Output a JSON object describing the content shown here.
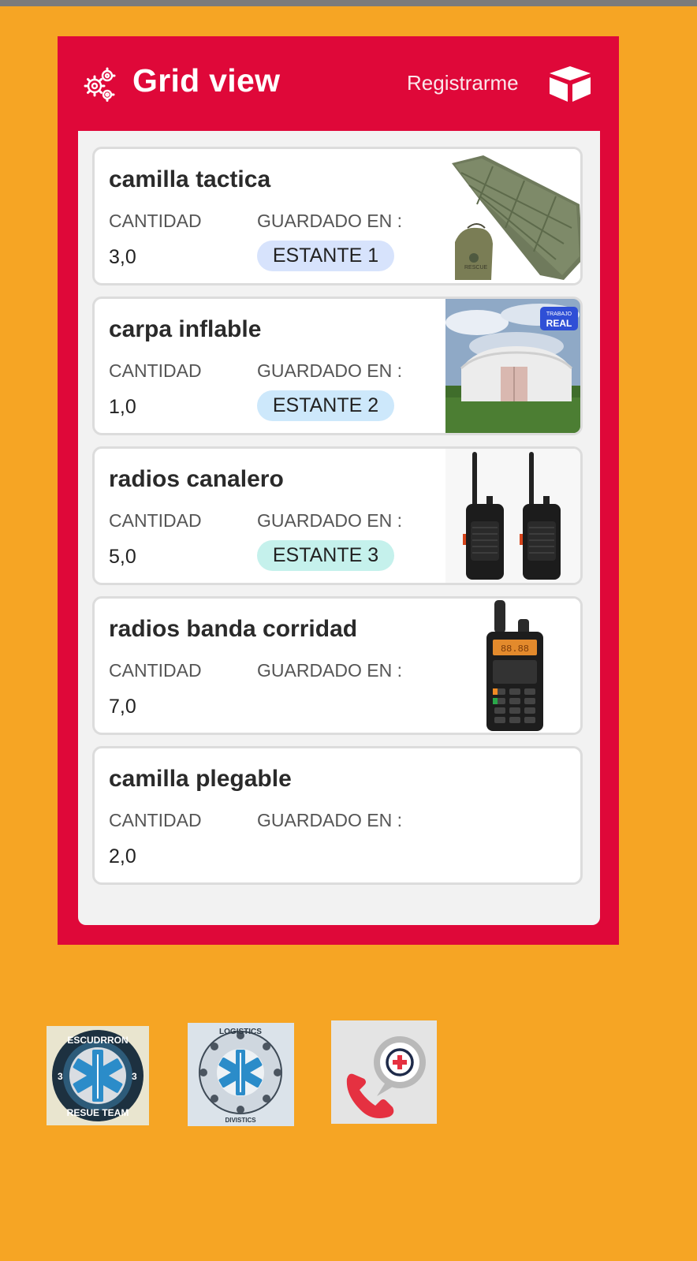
{
  "header": {
    "title": "Grid view",
    "register_label": "Registrarme",
    "settings_icon": "gears-icon",
    "box_icon": "cube-icon"
  },
  "labels": {
    "quantity": "CANTIDAD",
    "stored_in": "GUARDADO EN :"
  },
  "items": [
    {
      "name": "camilla tactica",
      "quantity": "3,0",
      "location": "ESTANTE 1",
      "badge_color": "#D7E3FC",
      "image": "tactical-stretcher-image"
    },
    {
      "name": "carpa inflable",
      "quantity": "1,0",
      "location": "ESTANTE 2",
      "badge_color": "#CDE8FB",
      "image": "inflatable-tent-image"
    },
    {
      "name": "radios canalero",
      "quantity": "5,0",
      "location": "ESTANTE 3",
      "badge_color": "#C5F1EC",
      "image": "walkie-talkie-pair-image"
    },
    {
      "name": "radios banda corridad",
      "quantity": "7,0",
      "location": "",
      "image": "dual-band-radio-image"
    },
    {
      "name": "camilla plegable",
      "quantity": "2,0",
      "location": "",
      "image": ""
    }
  ],
  "logos": [
    {
      "name": "escuadron-rescue-team-logo",
      "text_top": "ESCUDRRON",
      "text_bottom": "RESUE TEAM",
      "number": "3"
    },
    {
      "name": "logistics-logo",
      "text_top": "LOGISTICS",
      "text_bottom": "DIVISTICS"
    },
    {
      "name": "emergency-call-icon"
    }
  ],
  "tent_badge": {
    "line1": "TRABAJO",
    "line2": "REAL"
  },
  "colors": {
    "background": "#F6A524",
    "panel": "#DF0839",
    "card_border": "#DCDCDC"
  }
}
